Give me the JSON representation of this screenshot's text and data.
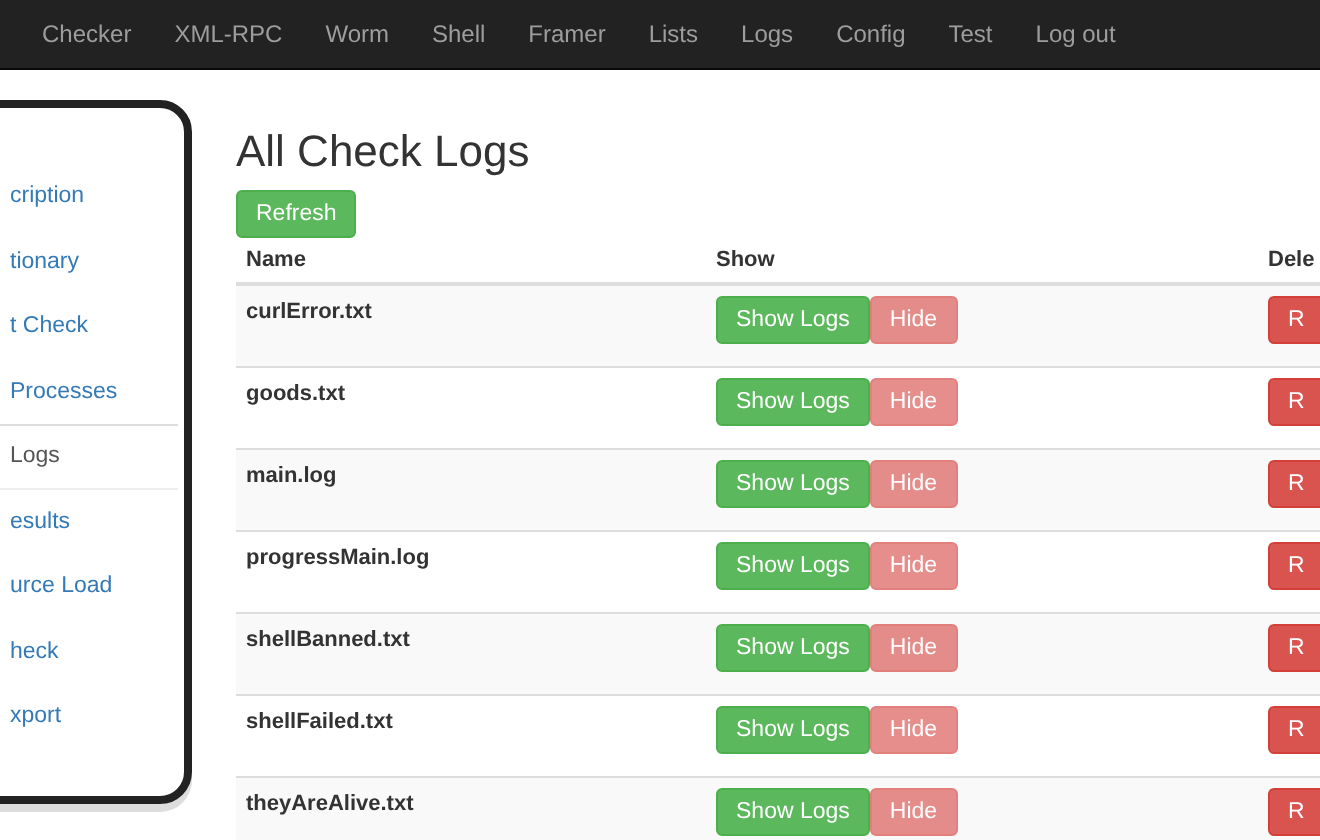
{
  "navbar": {
    "items": [
      "Checker",
      "XML-RPC",
      "Worm",
      "Shell",
      "Framer",
      "Lists",
      "Logs",
      "Config",
      "Test",
      "Log out"
    ]
  },
  "sidebar": {
    "items": [
      {
        "label": "cription",
        "selected": false
      },
      {
        "label": "tionary",
        "selected": false
      },
      {
        "label": "t Check",
        "selected": false
      },
      {
        "label": " Processes",
        "selected": false
      },
      {
        "label": " Logs",
        "selected": true
      },
      {
        "label": "esults",
        "selected": false
      },
      {
        "label": "urce Load",
        "selected": false
      },
      {
        "label": "heck",
        "selected": false
      },
      {
        "label": "xport",
        "selected": false
      }
    ]
  },
  "page": {
    "title": "All Check Logs",
    "refresh_button": "Refresh"
  },
  "table": {
    "columns": [
      "Name",
      "Show",
      "Dele"
    ],
    "rows": [
      {
        "name": "curlError.txt",
        "show_button": "Show Logs",
        "hide_button": "Hide",
        "hide_disabled": true,
        "delete_button": "R"
      },
      {
        "name": "goods.txt",
        "show_button": "Show Logs",
        "hide_button": "Hide",
        "hide_disabled": true,
        "delete_button": "R"
      },
      {
        "name": "main.log",
        "show_button": "Show Logs",
        "hide_button": "Hide",
        "hide_disabled": true,
        "delete_button": "R"
      },
      {
        "name": "progressMain.log",
        "show_button": "Show Logs",
        "hide_button": "Hide",
        "hide_disabled": true,
        "delete_button": "R"
      },
      {
        "name": "shellBanned.txt",
        "show_button": "Show Logs",
        "hide_button": "Hide",
        "hide_disabled": true,
        "delete_button": "R"
      },
      {
        "name": "shellFailed.txt",
        "show_button": "Show Logs",
        "hide_button": "Hide",
        "hide_disabled": true,
        "delete_button": "R"
      },
      {
        "name": "theyAreAlive.txt",
        "show_button": "Show Logs",
        "hide_button": "Hide",
        "hide_disabled": true,
        "delete_button": "R"
      }
    ]
  }
}
